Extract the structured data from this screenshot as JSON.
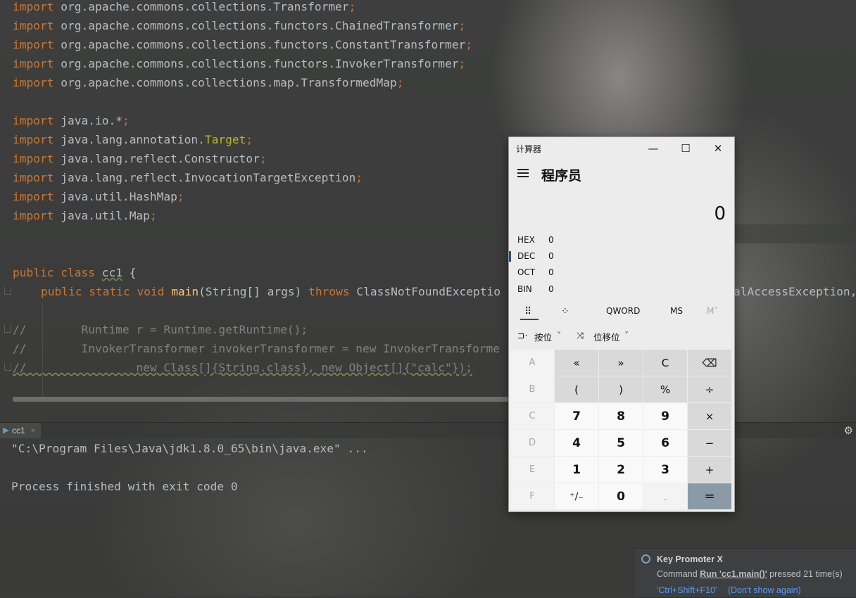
{
  "editor": {
    "imports": [
      {
        "kw": "import",
        "path": "org.apache.commons.collections.Transformer"
      },
      {
        "kw": "import",
        "path": "org.apache.commons.collections.functors.ChainedTransformer"
      },
      {
        "kw": "import",
        "path": "org.apache.commons.collections.functors.ConstantTransformer"
      },
      {
        "kw": "import",
        "path": "org.apache.commons.collections.functors.InvokerTransformer"
      },
      {
        "kw": "import",
        "path": "org.apache.commons.collections.map.TransformedMap"
      },
      {
        "kw": "import",
        "path": "java.io.*"
      },
      {
        "kw": "import",
        "path_a": "java.lang.annotation.",
        "path_b": "Target"
      },
      {
        "kw": "import",
        "path": "java.lang.reflect.Constructor"
      },
      {
        "kw": "import",
        "path": "java.lang.reflect.InvocationTargetException"
      },
      {
        "kw": "import",
        "path": "java.util.HashMap"
      },
      {
        "kw": "import",
        "path": "java.util.Map"
      }
    ],
    "semicolon": ";",
    "class_line": {
      "mods": "public class",
      "name": "cc1",
      "brace": "{"
    },
    "main_line": {
      "mods": "public static void",
      "method": "main",
      "params": "(String[] args)",
      "throws": "throws",
      "ex1": "ClassNotFoundExceptio",
      "ex2": "alAccessException,"
    },
    "comment_lines": [
      "//        Runtime r = Runtime.getRuntime();",
      "//        InvokerTransformer invokerTransformer = new InvokerTransforme",
      "//                new Class[]{String.class}, new Object[]{\"calc\"});"
    ]
  },
  "run": {
    "tab_label": "cc1",
    "tab_close": "×",
    "gear": "⚙",
    "console": [
      "\"C:\\Program Files\\Java\\jdk1.8.0_65\\bin\\java.exe\" ...",
      "Process finished with exit code 0"
    ]
  },
  "calculator": {
    "window_title": "计算器",
    "minimize": "—",
    "maximize": "☐",
    "close": "✕",
    "mode": "程序员",
    "display": "0",
    "radix": [
      {
        "label": "HEX",
        "value": "0",
        "selected": false
      },
      {
        "label": "DEC",
        "value": "0",
        "selected": true
      },
      {
        "label": "OCT",
        "value": "0",
        "selected": false
      },
      {
        "label": "BIN",
        "value": "0",
        "selected": false
      }
    ],
    "tabs": {
      "keypad": "⠿",
      "bitpad": "⁘",
      "word": "QWORD",
      "ms": "MS",
      "m": "M˅"
    },
    "ops": {
      "bitwise": "按位",
      "bitshift": "位移位",
      "caret": "˅"
    },
    "keys": [
      [
        "A",
        "«",
        "»",
        "C",
        "⌫"
      ],
      [
        "B",
        "(",
        ")",
        "%",
        "÷"
      ],
      [
        "C",
        "7",
        "8",
        "9",
        "×"
      ],
      [
        "D",
        "4",
        "5",
        "6",
        "−"
      ],
      [
        "E",
        "1",
        "2",
        "3",
        "+"
      ],
      [
        "F",
        "⁺∕₋",
        "0",
        ".",
        "="
      ]
    ]
  },
  "key_promoter": {
    "title": "Key Promoter X",
    "body_prefix": "Command ",
    "command": "Run 'cc1.main()'",
    "body_suffix": " pressed 21 time(s)",
    "shortcut": "'Ctrl+Shift+F10'",
    "dont_show": "(Don't show again)"
  },
  "colors": {
    "keyword": "#cc7832",
    "annotation": "#bbb529",
    "method": "#ffc66d",
    "comment": "#808080",
    "link": "#589df6",
    "accent": "#2b4b7a"
  }
}
